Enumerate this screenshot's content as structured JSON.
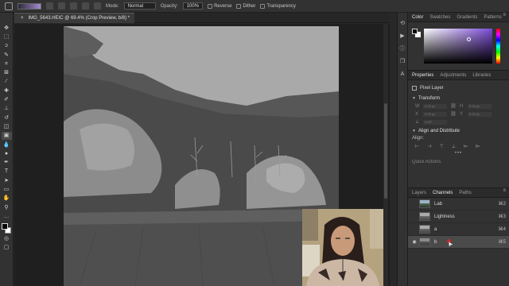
{
  "options_bar": {
    "mode_label": "Mode:",
    "mode_value": "Normal",
    "opacity_label": "Opacity:",
    "opacity_value": "100%",
    "reverse_label": "Reverse",
    "dither_label": "Dither",
    "transparency_label": "Transparency"
  },
  "document_tab": {
    "title": "IMG_5643.HEIC @ 69.4% (Crop Preview, b/8) *",
    "close_icon": "×"
  },
  "toolbar": {
    "tools": [
      {
        "name": "move-icon",
        "glyph": "✥"
      },
      {
        "name": "marquee-icon",
        "glyph": "⬚"
      },
      {
        "name": "lasso-icon",
        "glyph": "ↄ"
      },
      {
        "name": "quick-select-icon",
        "glyph": "✎"
      },
      {
        "name": "crop-icon",
        "glyph": "⌗"
      },
      {
        "name": "frame-icon",
        "glyph": "⊠"
      },
      {
        "name": "eyedropper-icon",
        "glyph": "⁄"
      },
      {
        "name": "healing-brush-icon",
        "glyph": "✚"
      },
      {
        "name": "brush-icon",
        "glyph": "✐"
      },
      {
        "name": "clone-stamp-icon",
        "glyph": "⊥"
      },
      {
        "name": "history-brush-icon",
        "glyph": "↺"
      },
      {
        "name": "eraser-icon",
        "glyph": "◫"
      },
      {
        "name": "gradient-icon",
        "glyph": "▣"
      },
      {
        "name": "blur-icon",
        "glyph": "💧"
      },
      {
        "name": "dodge-icon",
        "glyph": "●"
      },
      {
        "name": "pen-icon",
        "glyph": "✒"
      },
      {
        "name": "type-icon",
        "glyph": "T"
      },
      {
        "name": "path-select-icon",
        "glyph": "➤"
      },
      {
        "name": "rectangle-icon",
        "glyph": "▭"
      },
      {
        "name": "hand-icon",
        "glyph": "✋"
      },
      {
        "name": "zoom-icon",
        "glyph": "⚲"
      },
      {
        "name": "more-tools-icon",
        "glyph": "…"
      }
    ],
    "extra": [
      {
        "name": "quick-mask-icon",
        "glyph": "◎"
      },
      {
        "name": "screen-mode-icon",
        "glyph": "▢"
      }
    ]
  },
  "color_panel": {
    "tabs": [
      "Color",
      "Swatches",
      "Gradients",
      "Patterns"
    ],
    "active_tab": "Color",
    "menu_icon": "≡"
  },
  "properties_panel": {
    "tabs": [
      "Properties",
      "Adjustments",
      "Libraries"
    ],
    "active_tab": "Properties",
    "layer_kind": "Pixel Layer",
    "transform_label": "Transform",
    "transform_fields": [
      {
        "key": "W",
        "ph": "0.00 px",
        "key2": "H",
        "ph2": "0.00 px"
      },
      {
        "key": "X",
        "ph": "0.00 px",
        "key2": "Y",
        "ph2": "0.00 px"
      },
      {
        "key": "∠",
        "ph": "0.00°",
        "key2": "",
        "ph2": ""
      }
    ],
    "align_label": "Align and Distribute",
    "align_sub": "Align:",
    "align_icons": [
      "⊢",
      "⊣",
      "⊤",
      "⊥",
      "⊨",
      "⊫"
    ],
    "more_dots": "•••",
    "quick_actions": "Quick Actions"
  },
  "channels_panel": {
    "tabs": [
      "Layers",
      "Channels",
      "Paths"
    ],
    "active_tab": "Channels",
    "menu_icon": "≡",
    "rows": [
      {
        "name": "Lab",
        "shortcut": "⌘2",
        "visible": false,
        "thumb": "color"
      },
      {
        "name": "Lightness",
        "shortcut": "⌘3",
        "visible": false,
        "thumb": "gray"
      },
      {
        "name": "a",
        "shortcut": "⌘4",
        "visible": false,
        "thumb": "gray"
      },
      {
        "name": "b",
        "shortcut": "⌘5",
        "visible": true,
        "thumb": "dark",
        "selected": true
      }
    ]
  },
  "side_strip_icons": [
    "history-icon",
    "actions-icon",
    "info-icon",
    "layer-comps-icon",
    "character-icon"
  ],
  "colors": {
    "accent": "#7b4bd6",
    "panel_bg": "#323232",
    "canvas_bg": "#1f1f1f"
  }
}
